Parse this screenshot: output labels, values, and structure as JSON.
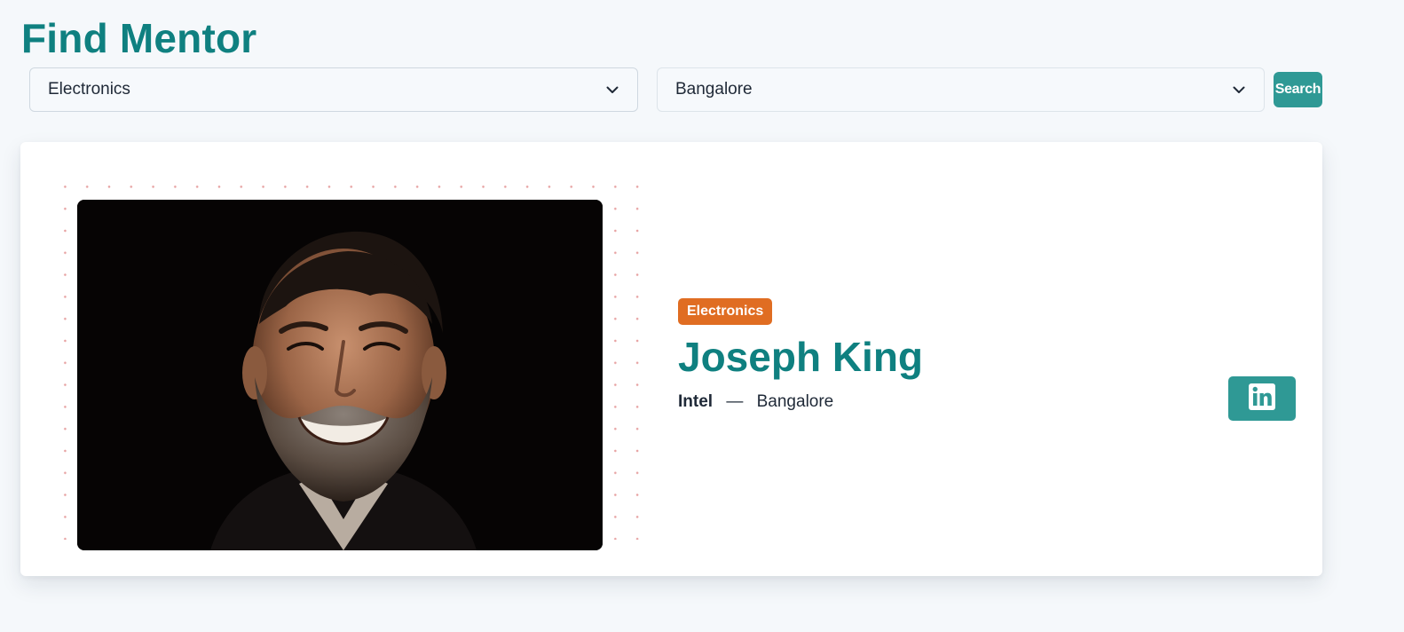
{
  "page": {
    "title": "Find Mentor"
  },
  "filters": {
    "category": {
      "selected": "Electronics",
      "icon": "chevron-down-icon"
    },
    "location": {
      "selected": "Bangalore",
      "icon": "chevron-down-icon"
    },
    "search_label": "Search"
  },
  "mentor": {
    "category": "Electronics",
    "name": "Joseph King",
    "company": "Intel",
    "separator": "—",
    "location": "Bangalore",
    "linkedin_icon": "linkedin-icon"
  },
  "colors": {
    "brand_teal": "#0f8080",
    "button_teal": "#2f9995",
    "badge_orange": "#e06d22",
    "dot_pink": "#e7a2a2",
    "background": "#f5f8fb"
  }
}
